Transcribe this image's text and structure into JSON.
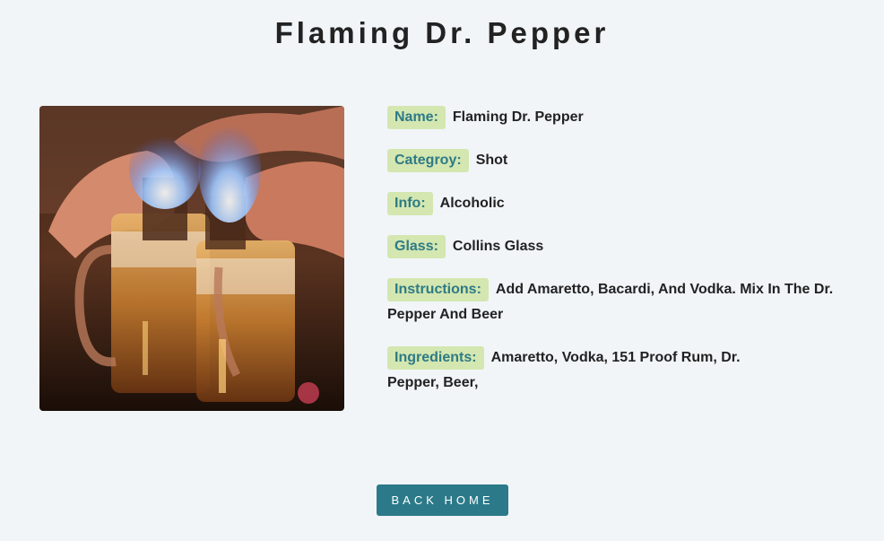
{
  "title": "Flaming Dr. Pepper",
  "photo": {
    "alt": "Flaming Dr. Pepper",
    "icon": "drink-photo"
  },
  "details": {
    "name_label": "Name:",
    "name_value": "Flaming Dr. Pepper",
    "category_label": "Categroy:",
    "category_value": "Shot",
    "info_label": "Info:",
    "info_value": "Alcoholic",
    "glass_label": "Glass:",
    "glass_value": "Collins Glass",
    "instructions_label": "Instructions:",
    "instructions_value": "Add Amaretto, Bacardi, And Vodka. Mix In The Dr. Pepper And Beer",
    "ingredients_label": "Ingredients:",
    "ingredients_value": "Amaretto,  Vodka,  151 Proof Rum,  Dr. Pepper,  Beer,"
  },
  "actions": {
    "back_home_label": "Back Home"
  },
  "colors": {
    "background": "#f1f5f8",
    "label_bg": "#d4e7b0",
    "label_text": "#2e7a86",
    "button_bg": "#2c7a89"
  }
}
